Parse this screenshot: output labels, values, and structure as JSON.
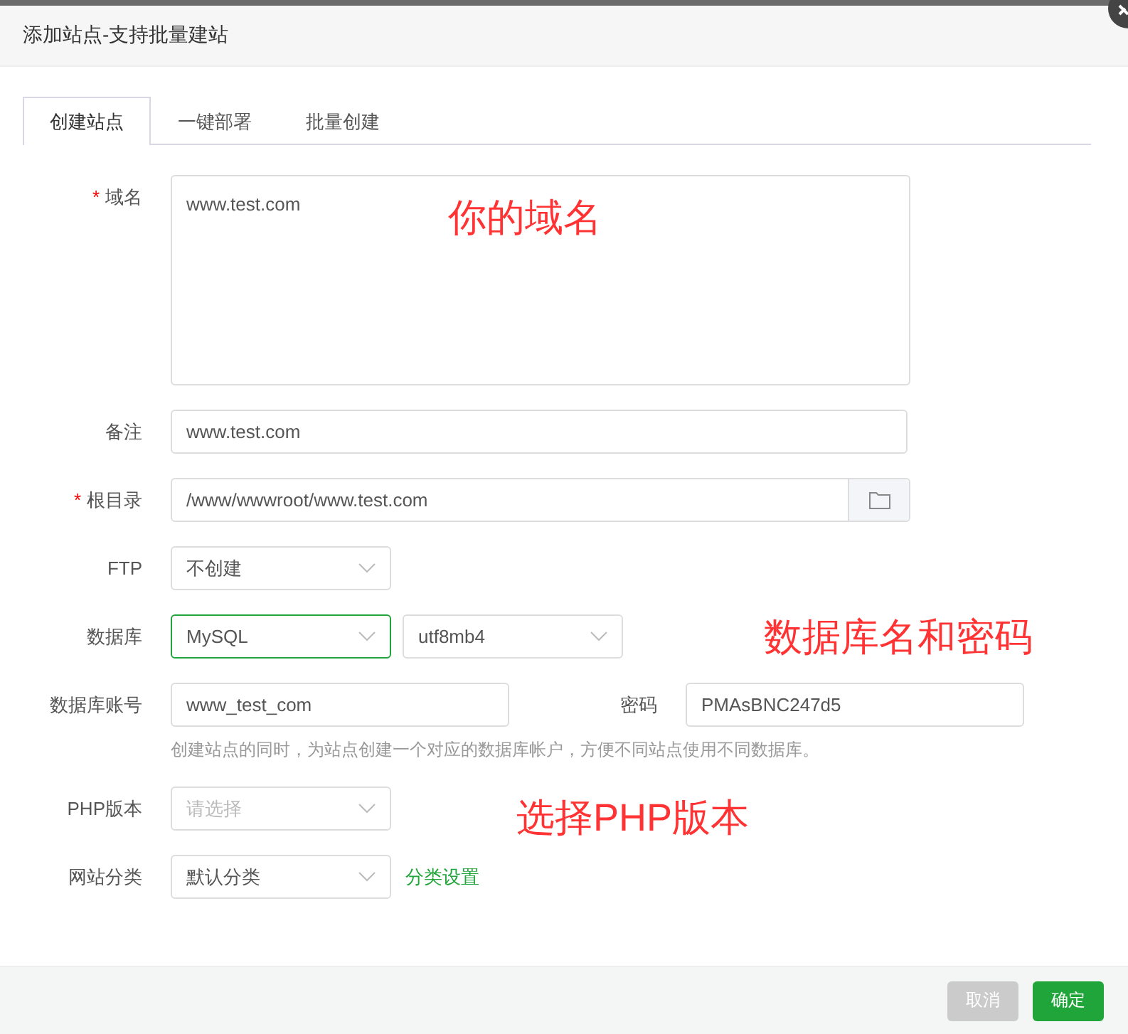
{
  "dialog": {
    "title": "添加站点-支持批量建站"
  },
  "tabs": [
    {
      "label": "创建站点",
      "selected": true
    },
    {
      "label": "一键部署",
      "selected": false
    },
    {
      "label": "批量创建",
      "selected": false
    }
  ],
  "rows": [
    {
      "kind": "textarea",
      "label": "域名",
      "required_mark": "*",
      "value": "www.test.com",
      "annotation": "你的域名"
    },
    {
      "kind": "input",
      "label": "备注",
      "value": "www.test.com"
    },
    {
      "kind": "path",
      "label": "根目录",
      "required_mark": "*",
      "value": "/www/wwwroot/www.test.com"
    },
    {
      "kind": "select",
      "label": "FTP",
      "selects": [
        {
          "value": "不创建",
          "focused": false
        }
      ]
    },
    {
      "kind": "select",
      "label": "数据库",
      "selects": [
        {
          "value": "MySQL",
          "focused": true
        },
        {
          "value": "utf8mb4",
          "focused": false
        }
      ],
      "annotation": "数据库名和密码"
    },
    {
      "kind": "account",
      "label": "数据库账号",
      "value": "www_test_com",
      "second_label": "密码",
      "second_value": "PMAsBNC247d5",
      "hint": "创建站点的同时，为站点创建一个对应的数据库帐户，方便不同站点使用不同数据库。"
    },
    {
      "kind": "select",
      "label": "PHP版本",
      "selects": [
        {
          "placeholder": "请选择",
          "focused": false
        }
      ],
      "annotation": "选择PHP版本"
    },
    {
      "kind": "select",
      "label": "网站分类",
      "selects": [
        {
          "value": "默认分类",
          "focused": false
        }
      ],
      "link": "分类设置"
    }
  ],
  "buttons": [
    {
      "label": "取消",
      "kind": "cancel"
    },
    {
      "label": "确定",
      "kind": "confirm"
    }
  ]
}
